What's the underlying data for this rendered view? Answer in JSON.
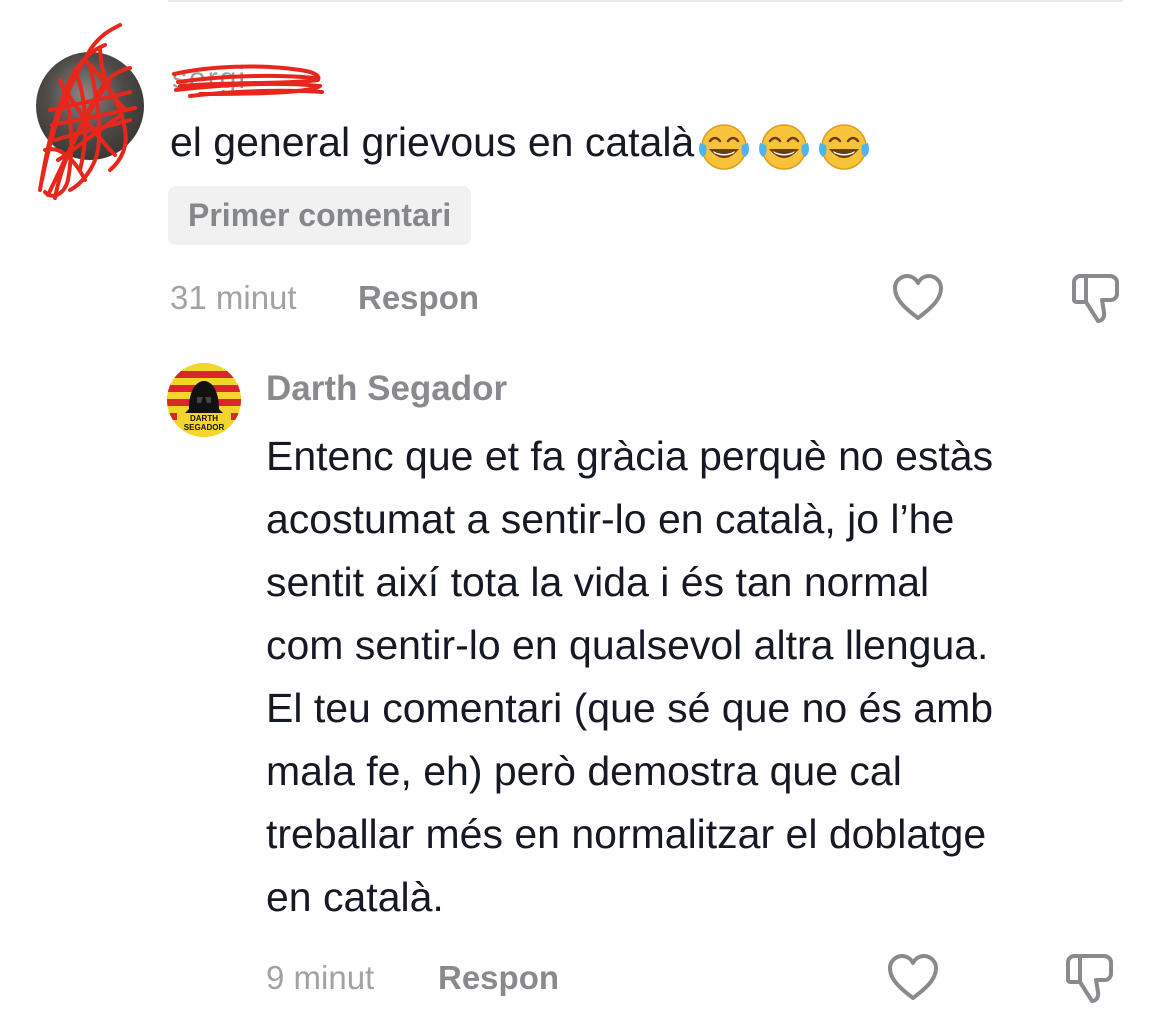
{
  "comments": [
    {
      "username": "sergi",
      "text": "el general grievous en català",
      "emojis": [
        "face-with-tears-of-joy",
        "face-with-tears-of-joy",
        "face-with-tears-of-joy"
      ],
      "badge": "Primer comentari",
      "time": "31 minut",
      "reply_label": "Respon",
      "like_icon": "heart-icon",
      "dislike_icon": "thumbs-down-icon",
      "redaction_color": "#e8271c"
    }
  ],
  "reply": {
    "username": "Darth Segador",
    "avatar_text": "DARTH SEGADOR",
    "avatar_colors": {
      "background": "#f4d52b",
      "stripes": "#d8262b"
    },
    "lines": [
      "Entenc que et fa gràcia perquè no estàs",
      "acostumat a sentir-lo en català, jo l’he",
      "sentit així tota la vida i és tan normal",
      "com sentir-lo en qualsevol altra llengua.",
      "El teu comentari (que sé que no és amb",
      "mala fe, eh) però demostra que cal",
      "treballar més en normalitzar el doblatge",
      "en català."
    ],
    "time": "9 minut",
    "reply_label": "Respon",
    "like_icon": "heart-icon",
    "dislike_icon": "thumbs-down-icon"
  }
}
